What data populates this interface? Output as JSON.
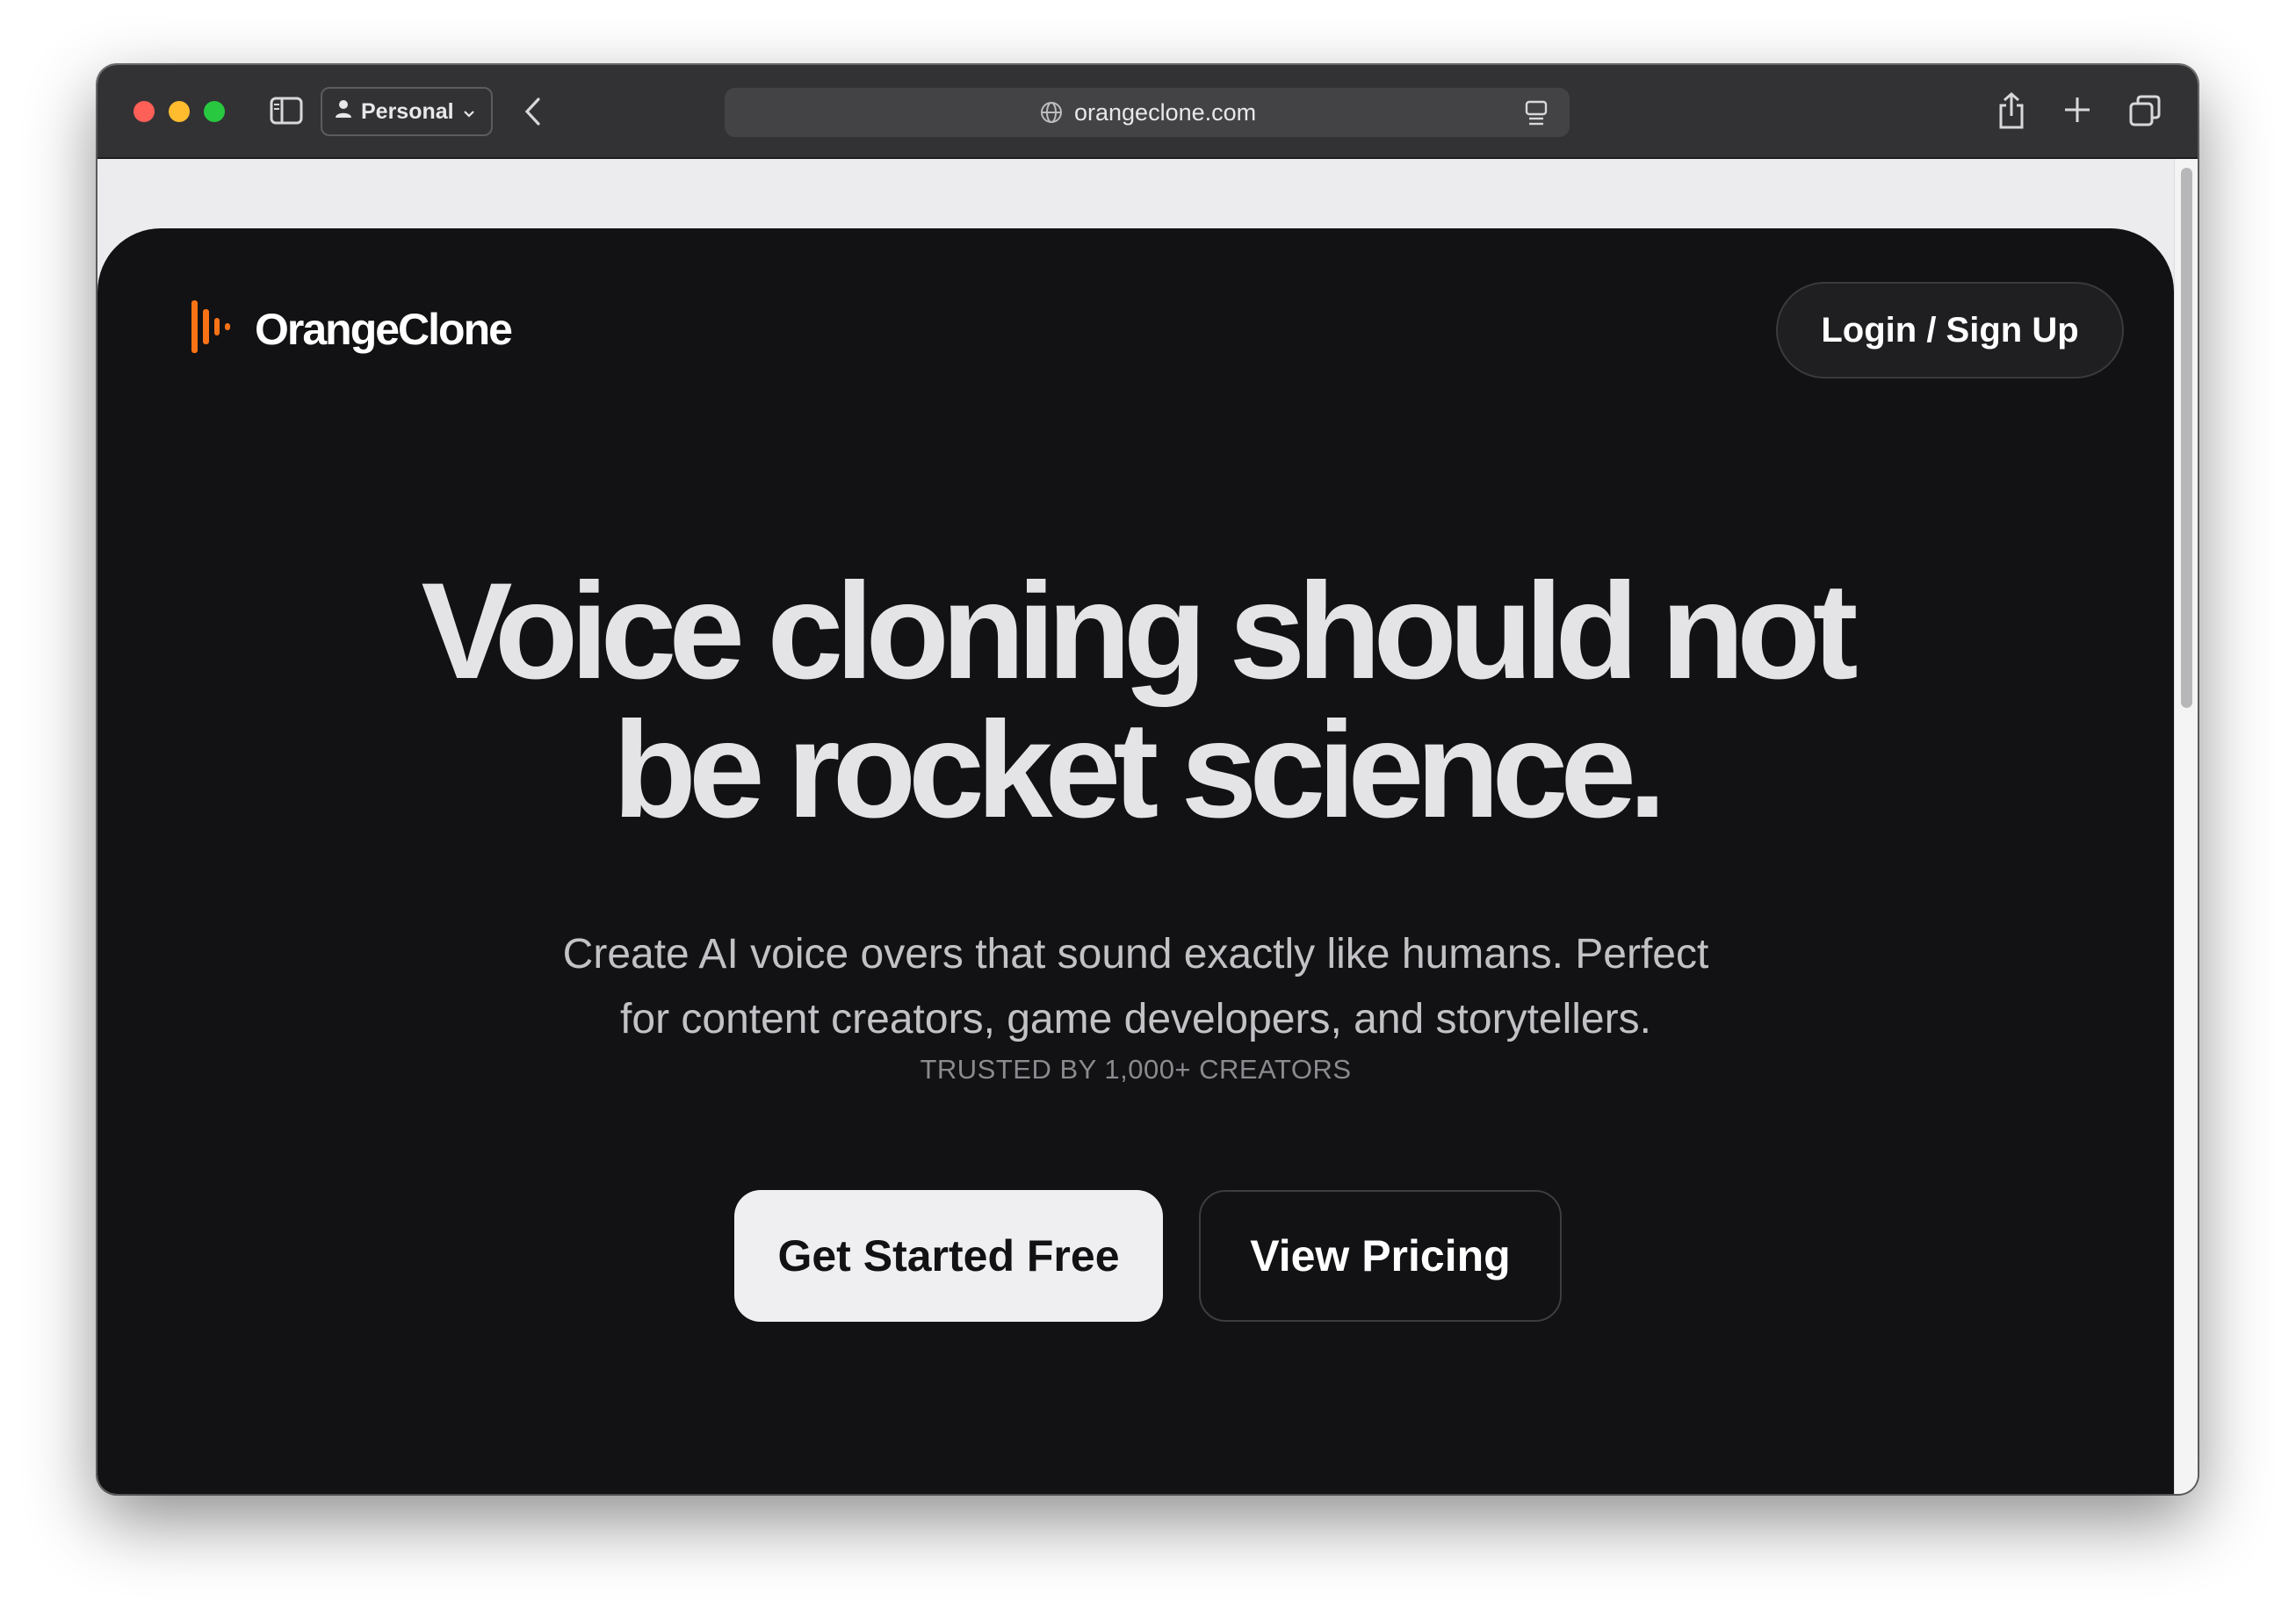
{
  "browser": {
    "profile_label": "Personal",
    "url": "orangeclone.com",
    "icons": [
      "sidebar-icon",
      "person-icon",
      "chevron-down-icon",
      "back-chevron-icon",
      "globe-icon",
      "reader-icon",
      "share-icon",
      "plus-icon",
      "tabs-icon"
    ]
  },
  "site": {
    "logo_text": "OrangeClone",
    "login_label": "Login / Sign Up",
    "headline_line1": "Voice cloning should not",
    "headline_line2": "be rocket science.",
    "subhead_line1": "Create AI voice overs that sound exactly like humans. Perfect",
    "subhead_line2": "for content creators, game developers, and storytellers.",
    "trusted": "TRUSTED BY 1,000+ CREATORS",
    "cta_primary": "Get Started Free",
    "cta_secondary": "View Pricing"
  },
  "colors": {
    "brand_orange": "#f97316",
    "hero_background": "#121214",
    "titlebar": "#323234"
  }
}
